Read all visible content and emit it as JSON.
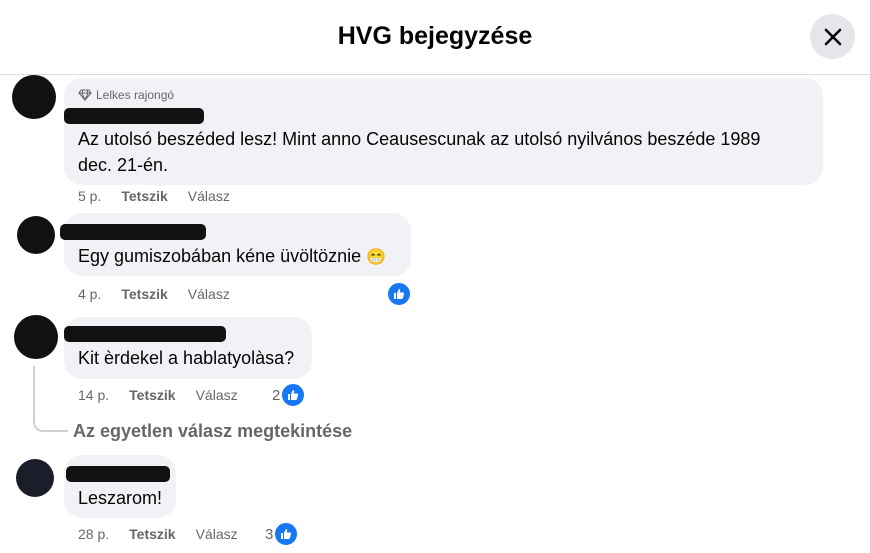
{
  "header": {
    "title": "HVG bejegyzése"
  },
  "comments": [
    {
      "badge": "Lelkes rajongó",
      "text_line1": "Az utolsó beszéded lesz! Mint anno Ceausescunak az utolsó nyilvános beszéde 1989",
      "text_line2": "dec. 21-én.",
      "time": "5 p.",
      "like_label": "Tetszik",
      "reply_label": "Válasz"
    },
    {
      "text": "Egy gumiszobában kéne üvöltöznie",
      "emoji": "😁",
      "time": "4 p.",
      "like_label": "Tetszik",
      "reply_label": "Válasz"
    },
    {
      "text": "Kit èrdekel a hablatyolàsa?",
      "time": "14 p.",
      "like_label": "Tetszik",
      "reply_label": "Válasz",
      "reaction_count": "2"
    },
    {
      "text": "Leszarom!",
      "time": "28 p.",
      "like_label": "Tetszik",
      "reply_label": "Válasz",
      "reaction_count": "3"
    }
  ],
  "view_replies": "Az egyetlen válasz megtekintése",
  "colors": {
    "accent": "#1877f2",
    "bubble": "#f0f2f5",
    "muted": "#65676b"
  }
}
